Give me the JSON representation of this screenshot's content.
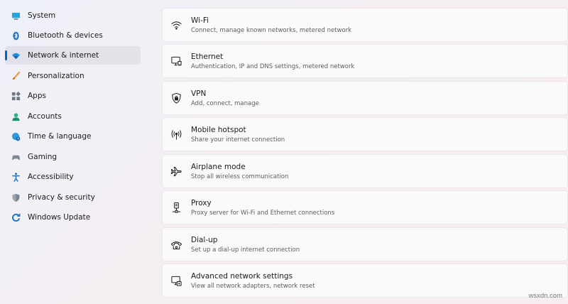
{
  "sidebar": {
    "items": [
      {
        "label": "System",
        "icon": "monitor-icon",
        "active": false
      },
      {
        "label": "Bluetooth & devices",
        "icon": "bluetooth-icon",
        "active": false
      },
      {
        "label": "Network & internet",
        "icon": "wifi-icon",
        "active": true
      },
      {
        "label": "Personalization",
        "icon": "paintbrush-icon",
        "active": false
      },
      {
        "label": "Apps",
        "icon": "apps-icon",
        "active": false
      },
      {
        "label": "Accounts",
        "icon": "person-icon",
        "active": false
      },
      {
        "label": "Time & language",
        "icon": "globe-clock-icon",
        "active": false
      },
      {
        "label": "Gaming",
        "icon": "gamepad-icon",
        "active": false
      },
      {
        "label": "Accessibility",
        "icon": "accessibility-icon",
        "active": false
      },
      {
        "label": "Privacy & security",
        "icon": "shield-icon",
        "active": false
      },
      {
        "label": "Windows Update",
        "icon": "update-icon",
        "active": false
      }
    ]
  },
  "main": {
    "cards": [
      {
        "title": "Wi-Fi",
        "subtitle": "Connect, manage known networks, metered network",
        "icon": "wifi-icon"
      },
      {
        "title": "Ethernet",
        "subtitle": "Authentication, IP and DNS settings, metered network",
        "icon": "ethernet-icon"
      },
      {
        "title": "VPN",
        "subtitle": "Add, connect, manage",
        "icon": "vpn-shield-icon"
      },
      {
        "title": "Mobile hotspot",
        "subtitle": "Share your internet connection",
        "icon": "hotspot-icon"
      },
      {
        "title": "Airplane mode",
        "subtitle": "Stop all wireless communication",
        "icon": "airplane-icon"
      },
      {
        "title": "Proxy",
        "subtitle": "Proxy server for Wi-Fi and Ethernet connections",
        "icon": "proxy-icon"
      },
      {
        "title": "Dial-up",
        "subtitle": "Set up a dial-up internet connection",
        "icon": "dialup-icon"
      },
      {
        "title": "Advanced network settings",
        "subtitle": "View all network adapters, network reset",
        "icon": "advanced-network-icon"
      }
    ]
  },
  "watermark": "wsxdn.com",
  "colors": {
    "accent": "#0067c0"
  }
}
